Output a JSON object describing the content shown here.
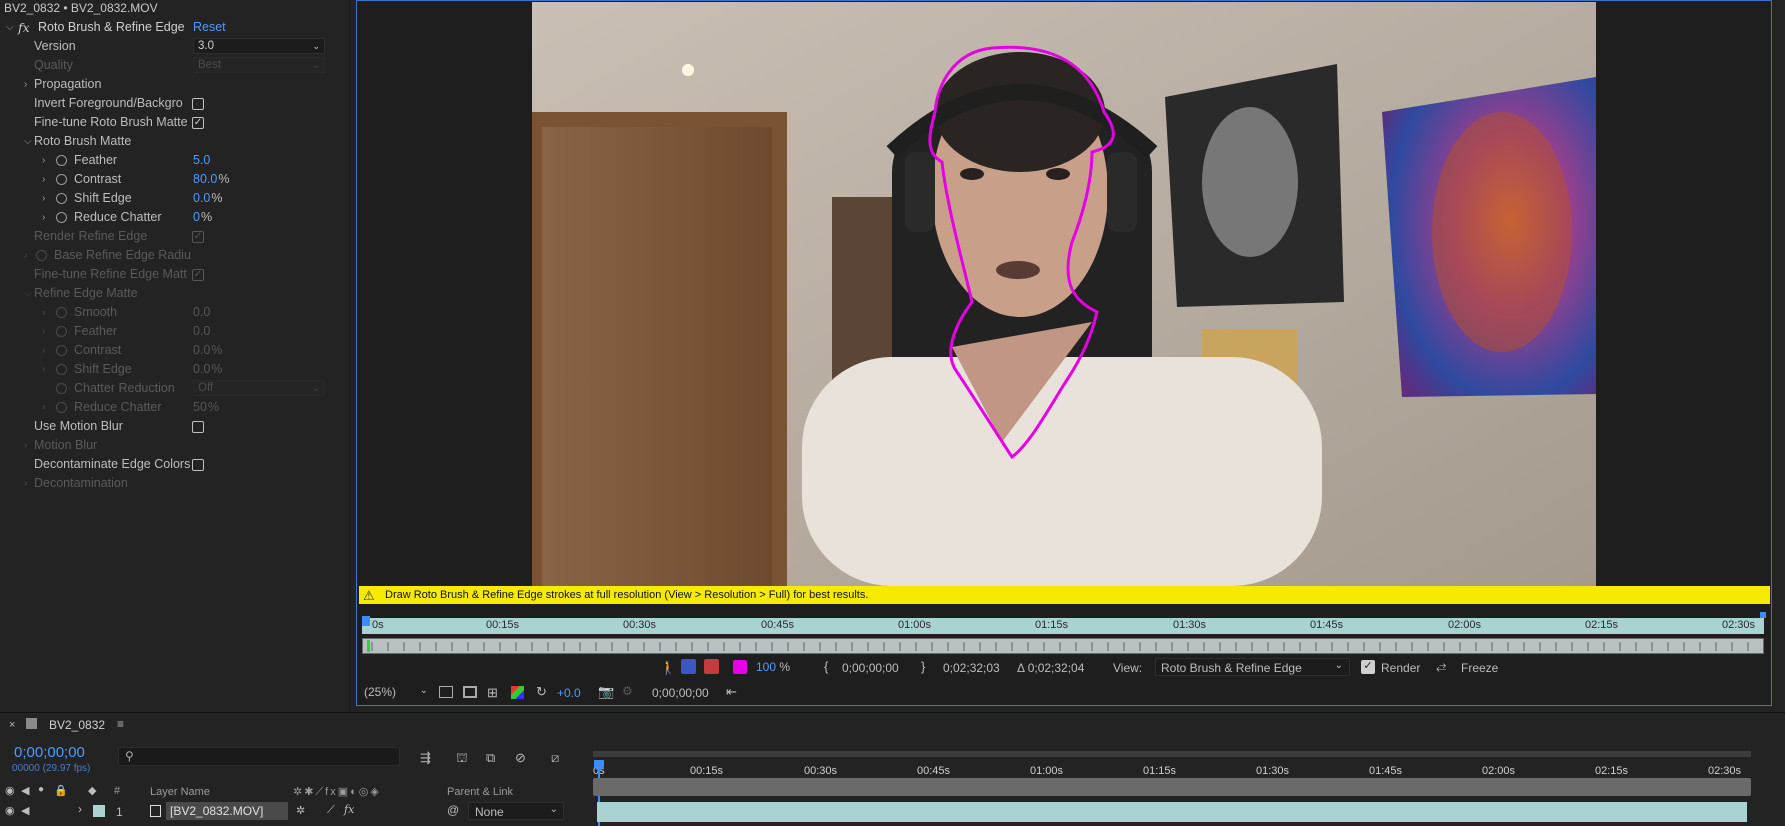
{
  "colors": {
    "accent_blue": "#4d9bff",
    "warning_yellow": "#f5ea00",
    "roto_magenta": "#e600e6",
    "ruler_teal": "#a9d3d0"
  },
  "effect_controls": {
    "source_title": "BV2_0832 • BV2_0832.MOV",
    "effect_name": "Roto Brush & Refine Edge",
    "fx_icon": "fx",
    "reset_label": "Reset",
    "rows": {
      "version": {
        "label": "Version",
        "value": "3.0"
      },
      "quality": {
        "label": "Quality",
        "value": "Best"
      },
      "propagation": {
        "label": "Propagation"
      },
      "invert": {
        "label": "Invert Foreground/Backgro"
      },
      "finetune_roto": {
        "label": "Fine-tune Roto Brush Matte"
      },
      "roto_matte": {
        "label": "Roto Brush Matte"
      },
      "feather": {
        "label": "Feather",
        "value": "5.0"
      },
      "contrast": {
        "label": "Contrast",
        "value": "80.0",
        "unit": "%"
      },
      "shift_edge": {
        "label": "Shift Edge",
        "value": "0.0",
        "unit": "%"
      },
      "reduce_chatter": {
        "label": "Reduce Chatter",
        "value": "0",
        "unit": "%"
      },
      "render_refine": {
        "label": "Render Refine Edge"
      },
      "base_refine_radius": {
        "label": "Base Refine Edge Radiu"
      },
      "finetune_refine": {
        "label": "Fine-tune Refine Edge Matt"
      },
      "refine_matte": {
        "label": "Refine Edge Matte"
      },
      "r_smooth": {
        "label": "Smooth",
        "value": "0.0"
      },
      "r_feather": {
        "label": "Feather",
        "value": "0.0"
      },
      "r_contrast": {
        "label": "Contrast",
        "value": "0.0",
        "unit": "%"
      },
      "r_shift_edge": {
        "label": "Shift Edge",
        "value": "0.0",
        "unit": "%"
      },
      "r_chatter_reduction": {
        "label": "Chatter Reduction",
        "value": "Off"
      },
      "r_reduce_chatter": {
        "label": "Reduce Chatter",
        "value": "50",
        "unit": "%"
      },
      "motion_blur_toggle": {
        "label": "Use Motion Blur"
      },
      "motion_blur": {
        "label": "Motion Blur"
      },
      "decontaminate_toggle": {
        "label": "Decontaminate Edge Colors"
      },
      "decontamination": {
        "label": "Decontamination"
      }
    }
  },
  "viewer": {
    "warning_text": "Draw Roto Brush & Refine Edge strokes at full resolution (View > Resolution > Full) for best results.",
    "ruler_ticks": [
      "0s",
      "00:15s",
      "00:30s",
      "00:45s",
      "01:00s",
      "01:15s",
      "01:30s",
      "01:45s",
      "02:00s",
      "02:15s",
      "02:30s"
    ],
    "overlay_opacity": "100",
    "overlay_unit": "%",
    "in_point": "0;00;00;00",
    "out_point": "0;02;32;03",
    "duration": "Δ 0;02;32;04",
    "view_label": "View:",
    "view_value": "Roto Brush & Refine Edge",
    "render_label": "Render",
    "freeze_label": "Freeze",
    "zoom": "(25%)",
    "exposure": "+0.0",
    "current_time": "0;00;00;00"
  },
  "timeline": {
    "comp_name": "BV2_0832",
    "timecode": "0;00;00;00",
    "frame_info": "00000 (29.97 fps)",
    "search_placeholder": "",
    "col_hash": "#",
    "col_layer_name": "Layer Name",
    "col_parent": "Parent & Link",
    "ruler_ticks": [
      "0s",
      "00:15s",
      "00:30s",
      "00:45s",
      "01:00s",
      "01:15s",
      "01:30s",
      "01:45s",
      "02:00s",
      "02:15s",
      "02:30s"
    ],
    "layer": {
      "index": "1",
      "name": "[BV2_0832.MOV]",
      "parent": "None"
    }
  }
}
